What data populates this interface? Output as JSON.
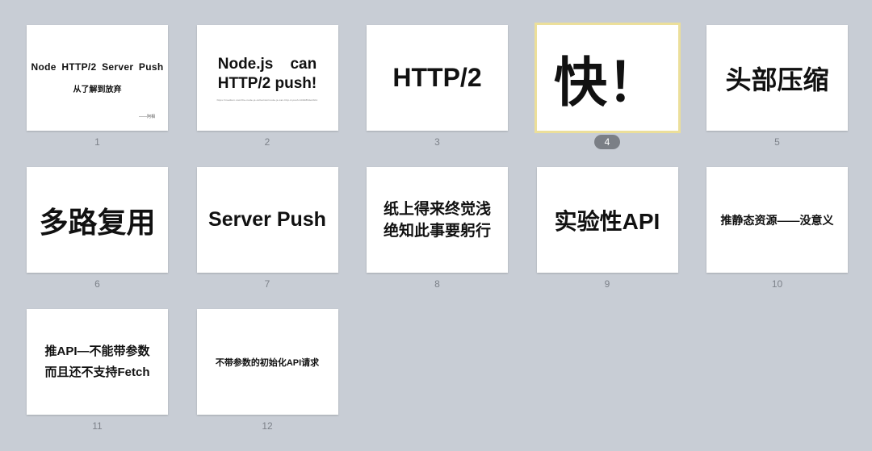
{
  "view": "slide-sorter",
  "selected_slide": 4,
  "colors": {
    "background": "#c8cdd5",
    "slide_background": "#ffffff",
    "selection_border": "#ecdf9a",
    "selected_badge": "#7b7f86",
    "slide_number": "#7d828a"
  },
  "slides": [
    {
      "number": "1",
      "lines": [
        "Node HTTP/2 Server Push",
        "从了解到放弃"
      ],
      "author": "——阿相"
    },
    {
      "number": "2",
      "lines": [
        "Node.js    can",
        "HTTP/2 push!"
      ],
      "link": "https://medium.com/the-node-js-collection/node-js-can-http-2-push-b491894e1bb1"
    },
    {
      "number": "3",
      "lines": [
        "HTTP/2"
      ]
    },
    {
      "number": "4",
      "lines": [
        "快！"
      ]
    },
    {
      "number": "5",
      "lines": [
        "头部压缩"
      ]
    },
    {
      "number": "6",
      "lines": [
        "多路复用"
      ]
    },
    {
      "number": "7",
      "lines": [
        "Server Push"
      ]
    },
    {
      "number": "8",
      "lines": [
        "纸上得来终觉浅",
        "绝知此事要躬行"
      ]
    },
    {
      "number": "9",
      "lines": [
        "实验性API"
      ]
    },
    {
      "number": "10",
      "lines": [
        "推静态资源——没意义"
      ]
    },
    {
      "number": "11",
      "lines": [
        "推API—不能带参数",
        "而且还不支持Fetch"
      ]
    },
    {
      "number": "12",
      "lines": [
        "不带参数的初始化API请求"
      ]
    }
  ]
}
